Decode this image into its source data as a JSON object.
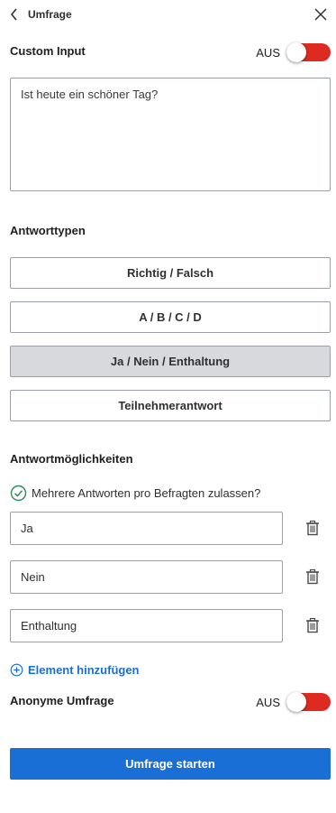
{
  "header": {
    "title": "Umfrage"
  },
  "custom_input": {
    "title": "Custom Input",
    "toggle_label": "AUS",
    "toggle_on": false
  },
  "question": {
    "value": "Ist heute ein schöner Tag?"
  },
  "answer_types": {
    "title": "Antworttypen",
    "options": [
      "Richtig / Falsch",
      "A / B / C / D",
      "Ja / Nein / Enthaltung",
      "Teilnehmerantwort"
    ],
    "selected": "Ja / Nein / Enthaltung"
  },
  "answer_options": {
    "title": "Antwortmöglichkeiten",
    "multiple_label": "Mehrere Antworten pro Befragten zulassen?",
    "items": [
      "Ja",
      "Nein",
      "Enthaltung"
    ],
    "add_label": "Element hinzufügen"
  },
  "anonymous": {
    "title": "Anonyme Umfrage",
    "toggle_label": "AUS",
    "toggle_on": false
  },
  "start_button": {
    "label": "Umfrage starten"
  },
  "colors": {
    "accent": "#1a6fd6",
    "toggle_off": "#dd2b22",
    "check": "#2e8b57",
    "selected_bg": "#d7d9dd"
  }
}
